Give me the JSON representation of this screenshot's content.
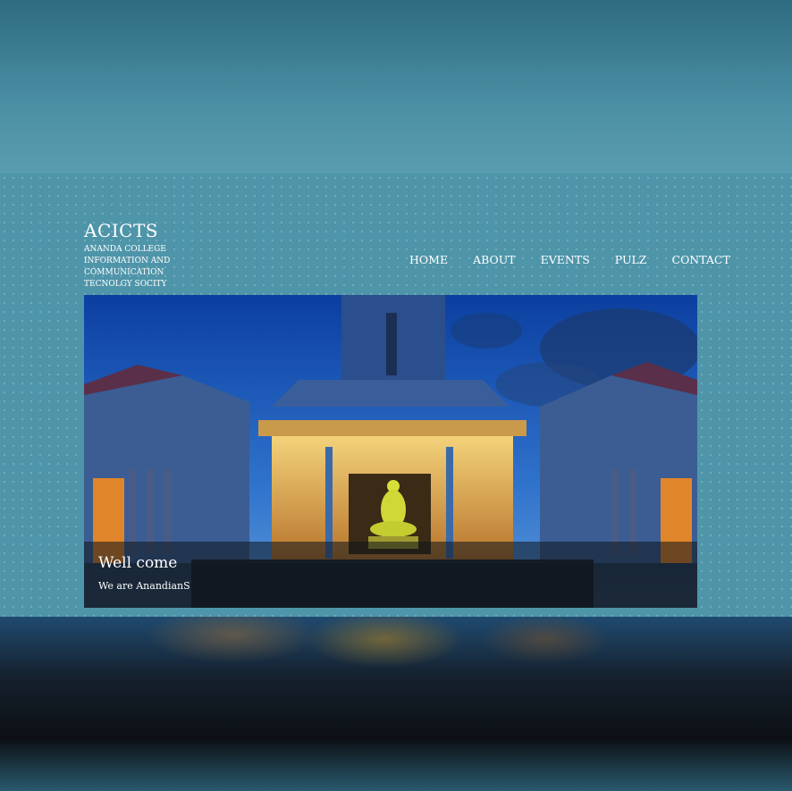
{
  "brand": {
    "title": "ACICTS",
    "subtitle": "ANANDA COLLEGE INFORMATION AND COMMUNICATION TECNOLGY SOCITY"
  },
  "nav": {
    "items": [
      {
        "label": "HOME"
      },
      {
        "label": "ABOUT"
      },
      {
        "label": "EVENTS"
      },
      {
        "label": "PULZ"
      },
      {
        "label": "CONTACT"
      }
    ]
  },
  "hero": {
    "caption_title": "Well come",
    "caption_subtitle": "We are AnandianS"
  },
  "colors": {
    "page_background": "#4f95a9",
    "caption_overlay": "#0f141c"
  }
}
